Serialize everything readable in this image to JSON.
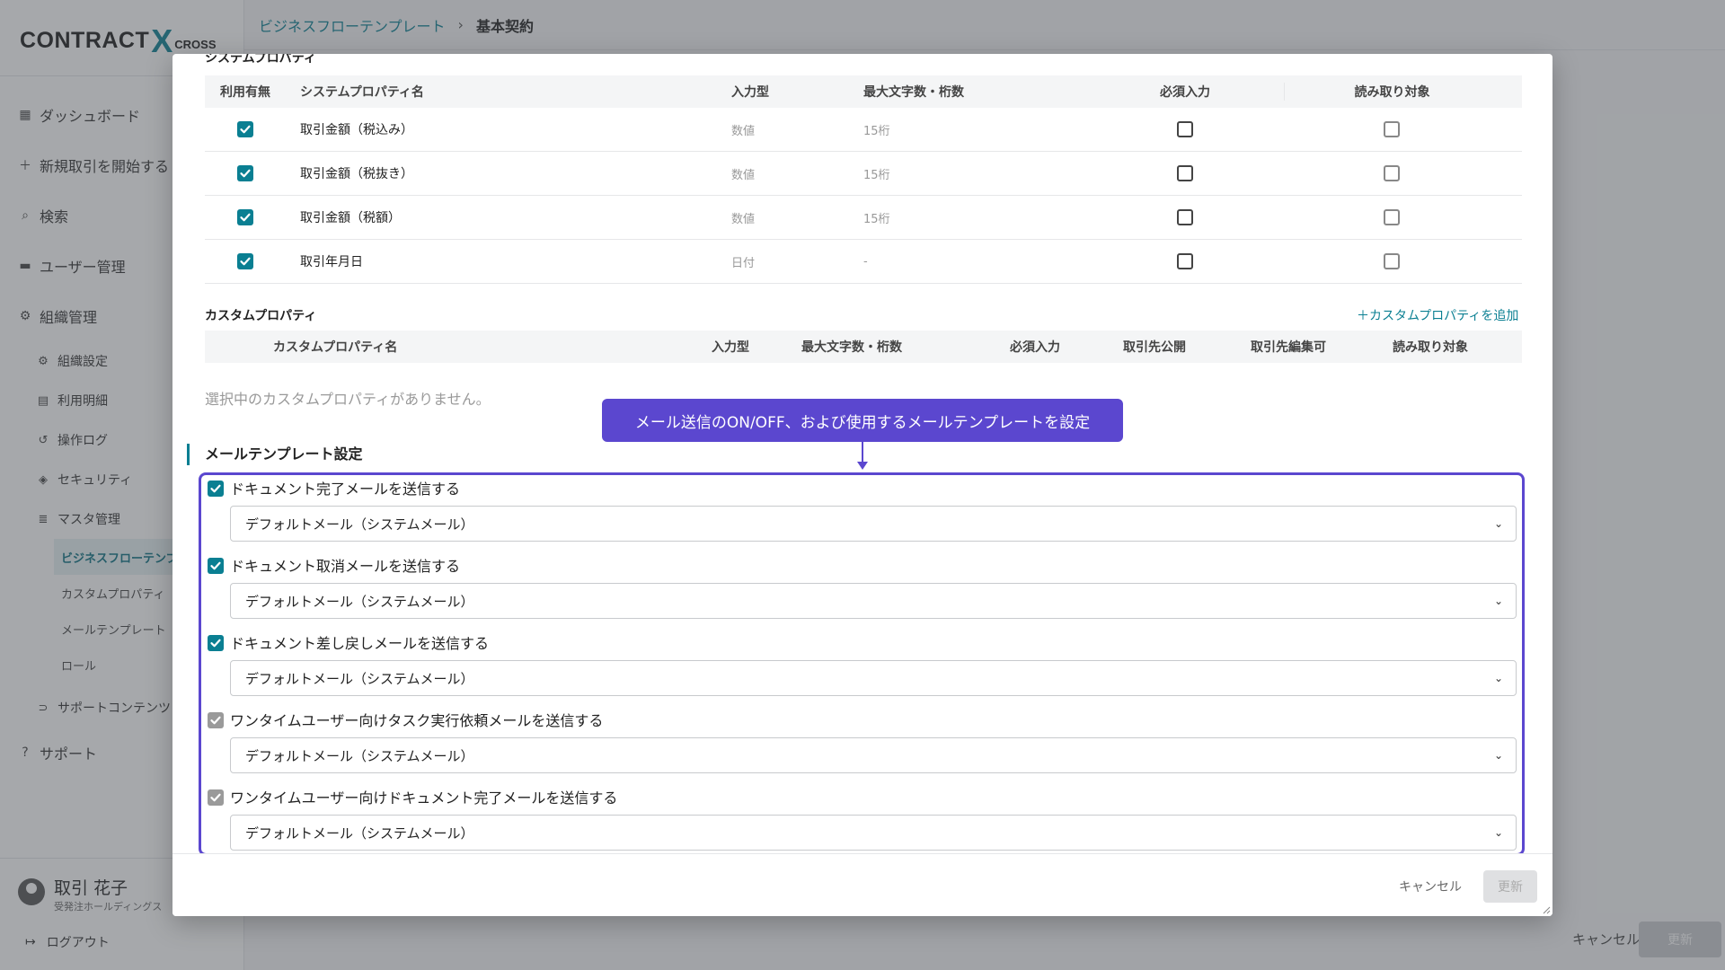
{
  "logo": {
    "main": "CONTRACT",
    "x": "X",
    "sub": "CROSS"
  },
  "breadcrumb": {
    "link": "ビジネスフローテンプレート",
    "separator": "›",
    "current": "基本契約"
  },
  "nav": {
    "dashboard": "ダッシュボード",
    "new_deal": "新規取引を開始する",
    "search": "検索",
    "user_mgmt": "ユーザー管理",
    "org_mgmt": "組織管理",
    "org_settings": "組織設定",
    "usage": "利用明細",
    "oplog": "操作ログ",
    "security": "セキュリティ",
    "master": "マスタ管理",
    "bizflow": "ビジネスフローテンプレート",
    "custom_prop": "カスタムプロパティ",
    "mail_tpl": "メールテンプレート",
    "role": "ロール",
    "support_contents": "サポートコンテンツ",
    "support": "サポート"
  },
  "user": {
    "name": "取引 花子",
    "org": "受発注ホールディングス"
  },
  "logout": "ログアウト",
  "background_footer": {
    "cancel": "キャンセル",
    "update": "更新"
  },
  "modal": {
    "system_section_title": "システムプロパティ",
    "system_table": {
      "headers": [
        "利用有無",
        "システムプロパティ名",
        "入力型",
        "最大文字数・桁数",
        "必須入力",
        "読み取り対象"
      ],
      "rows": [
        {
          "enabled": true,
          "name": "取引金額（税込み）",
          "type": "数値",
          "max": "15桁",
          "required": false,
          "readable": false
        },
        {
          "enabled": true,
          "name": "取引金額（税抜き）",
          "type": "数値",
          "max": "15桁",
          "required": false,
          "readable": false
        },
        {
          "enabled": true,
          "name": "取引金額（税額）",
          "type": "数値",
          "max": "15桁",
          "required": false,
          "readable": false
        },
        {
          "enabled": true,
          "name": "取引年月日",
          "type": "日付",
          "max": "-",
          "required": false,
          "readable": false
        }
      ]
    },
    "custom_section_title": "カスタムプロパティ",
    "custom_add": "＋カスタムプロパティを追加",
    "custom_table": {
      "headers": [
        "カスタムプロパティ名",
        "入力型",
        "最大文字数・桁数",
        "必須入力",
        "取引先公開",
        "取引先編集可",
        "読み取り対象"
      ]
    },
    "custom_empty": "選択中のカスタムプロパティがありません。",
    "callout": "メール送信のON/OFF、および使用するメールテンプレートを設定",
    "mail_section_title": "メールテンプレート設定",
    "mail_items": [
      {
        "checked": true,
        "style": "on",
        "label": "ドキュメント完了メールを送信する",
        "template": "デフォルトメール（システムメール）"
      },
      {
        "checked": true,
        "style": "on",
        "label": "ドキュメント取消メールを送信する",
        "template": "デフォルトメール（システムメール）"
      },
      {
        "checked": true,
        "style": "on",
        "label": "ドキュメント差し戻しメールを送信する",
        "template": "デフォルトメール（システムメール）"
      },
      {
        "checked": true,
        "style": "grey",
        "label": "ワンタイムユーザー向けタスク実行依頼メールを送信する",
        "template": "デフォルトメール（システムメール）"
      },
      {
        "checked": true,
        "style": "grey",
        "label": "ワンタイムユーザー向けドキュメント完了メールを送信する",
        "template": "デフォルトメール（システムメール）"
      }
    ],
    "footer": {
      "cancel": "キャンセル",
      "update": "更新"
    }
  },
  "colors": {
    "accent": "#0a7f92",
    "callout": "#5b47cf"
  },
  "icons": [
    "dashboard-icon",
    "plus-icon",
    "search-icon",
    "folder-icon",
    "gear-icon",
    "receipt-icon",
    "history-icon",
    "shield-icon",
    "database-icon",
    "link-icon",
    "help-icon",
    "avatar-icon",
    "logout-icon",
    "chevron-down-icon",
    "check-icon"
  ]
}
